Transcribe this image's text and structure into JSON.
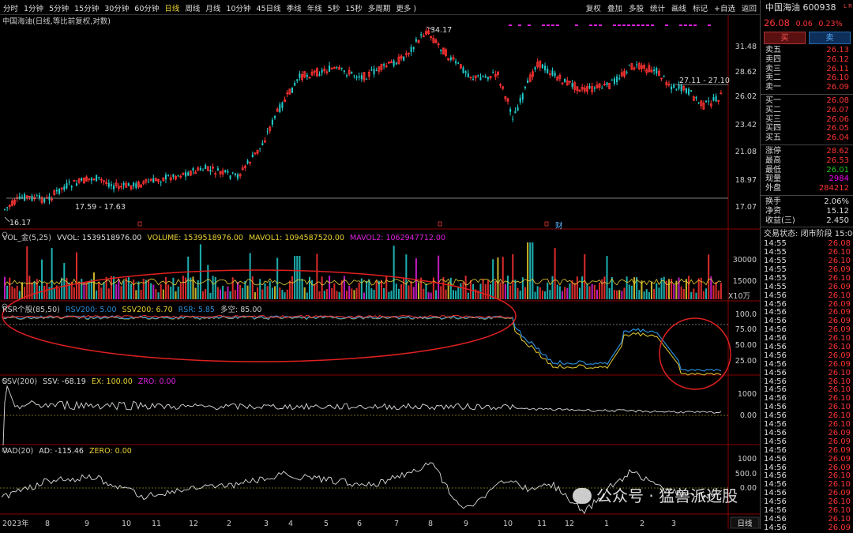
{
  "toolbar": {
    "periods": [
      "分时",
      "1分钟",
      "5分钟",
      "15分钟",
      "30分钟",
      "60分钟",
      "日线",
      "周线",
      "月线",
      "10分钟",
      "45日线",
      "季线",
      "年线",
      "5秒",
      "15秒",
      "多周期",
      "更多 )"
    ],
    "active_period": "日线",
    "tools": [
      "复权",
      "叠加",
      "多股",
      "统计",
      "画线",
      "标记",
      "+自选",
      "返回"
    ]
  },
  "main_pane": {
    "title": "中国海油(日线,等比前复权,对数)",
    "y_ticks": [
      "31.48",
      "28.62",
      "26.02",
      "23.42",
      "21.08",
      "18.97",
      "17.07"
    ],
    "annotations": {
      "high": "34.17",
      "low": "16.17",
      "support": "17.59 - 17.63",
      "resistance": "27.11 - 27.10"
    },
    "event_markers": [
      "财"
    ]
  },
  "vol_pane": {
    "label_name": "VOL_金(5,25)",
    "vvol": "VVOL: 1539518976.00",
    "volume": "VOLUME: 1539518976.00",
    "mavol1": "MAVOL1: 1094587520.00",
    "mavol2": "MAVOL2: 1062947712.00",
    "y_ticks": [
      "30000",
      "15000"
    ],
    "unit": "X10万"
  },
  "rsr_pane": {
    "label_name": "RSR个股(85,50)",
    "rsv200": "RSV200: 5.00",
    "ssv200": "SSV200: 6.70",
    "rsr": "RSR: 5.85",
    "duokong": "多空: 85.00",
    "y_ticks": [
      "100.0",
      "75.00",
      "50.00",
      "25.00"
    ]
  },
  "ssv_pane": {
    "label_name": "SSV(200)",
    "ssv": "SSV: -68.19",
    "ex": "EX: 100.00",
    "zro": "ZRO: 0.00",
    "y_ticks": [
      "1000",
      "0.00"
    ]
  },
  "vad_pane": {
    "label_name": "VAD(20)",
    "ad": "AD: -115.46",
    "zero": "ZERO: 0.00",
    "y_ticks": [
      "1000",
      "500.0",
      "0.00"
    ]
  },
  "x_axis": {
    "labels": [
      "2023年",
      "8",
      "9",
      "10",
      "11",
      "12",
      "2",
      "3",
      "4",
      "5",
      "6",
      "7",
      "8",
      "9",
      "10",
      "11",
      "12",
      "1",
      "2",
      "3"
    ],
    "period_tag": "日线"
  },
  "quote_panel": {
    "name": "中国海油",
    "code": "600938",
    "lr_tag": "L R",
    "price": "26.08",
    "change": "0.06",
    "change_pct": "0.23%",
    "buy_label": "买",
    "sell_label": "卖",
    "asks": [
      {
        "label": "卖五",
        "price": "26.13"
      },
      {
        "label": "卖四",
        "price": "26.12"
      },
      {
        "label": "卖三",
        "price": "26.11"
      },
      {
        "label": "卖二",
        "price": "26.10"
      },
      {
        "label": "卖一",
        "price": "26.09"
      }
    ],
    "bids": [
      {
        "label": "买一",
        "price": "26.08"
      },
      {
        "label": "买二",
        "price": "26.07"
      },
      {
        "label": "买三",
        "price": "26.06"
      },
      {
        "label": "买四",
        "price": "26.05"
      },
      {
        "label": "买五",
        "price": "26.04"
      }
    ],
    "stats": [
      {
        "label": "涨停",
        "value": "28.62"
      },
      {
        "label": "最高",
        "value": "26.53"
      },
      {
        "label": "最低",
        "value": "26.01"
      },
      {
        "label": "现量",
        "value": "2984"
      },
      {
        "label": "外盘",
        "value": "284212"
      }
    ],
    "stats2": [
      {
        "label": "换手",
        "value": "2.06%"
      },
      {
        "label": "净资",
        "value": "15.12"
      },
      {
        "label": "收益(三)",
        "value": "2.450"
      }
    ],
    "trade_status": "交易状态: 闭市阶段 15:00",
    "ticks": [
      {
        "time": "14:55",
        "price": "26.08"
      },
      {
        "time": "14:55",
        "price": "26.10"
      },
      {
        "time": "14:55",
        "price": "26.10"
      },
      {
        "time": "14:55",
        "price": "26.09"
      },
      {
        "time": "14:55",
        "price": "26.10"
      },
      {
        "time": "14:55",
        "price": "26.09"
      },
      {
        "time": "14:56",
        "price": "26.10"
      },
      {
        "time": "14:56",
        "price": "26.09"
      },
      {
        "time": "14:56",
        "price": "26.09"
      },
      {
        "time": "14:56",
        "price": "26.09"
      },
      {
        "time": "14:56",
        "price": "26.09"
      },
      {
        "time": "14:56",
        "price": "26.10"
      },
      {
        "time": "14:56",
        "price": "26.10"
      },
      {
        "time": "14:56",
        "price": "26.09"
      },
      {
        "time": "14:56",
        "price": "26.09"
      },
      {
        "time": "14:56",
        "price": "26.10"
      },
      {
        "time": "14:56",
        "price": "26.10"
      },
      {
        "time": "14:56",
        "price": "26.10"
      },
      {
        "time": "14:56",
        "price": "26.10"
      },
      {
        "time": "14:56",
        "price": "26.10"
      },
      {
        "time": "14:56",
        "price": "26.10"
      },
      {
        "time": "14:56",
        "price": "26.10"
      },
      {
        "time": "14:56",
        "price": "26.09"
      },
      {
        "time": "14:56",
        "price": "26.09"
      },
      {
        "time": "14:56",
        "price": "26.09"
      },
      {
        "time": "14:56",
        "price": "26.09"
      },
      {
        "time": "14:56",
        "price": "26.09"
      },
      {
        "time": "14:56",
        "price": "26.10"
      },
      {
        "time": "14:56",
        "price": "26.10"
      },
      {
        "time": "14:56",
        "price": "26.09"
      },
      {
        "time": "14:56",
        "price": "26.10"
      },
      {
        "time": "14:56",
        "price": "26.10"
      },
      {
        "time": "14:56",
        "price": "26.10"
      },
      {
        "time": "14:56",
        "price": "26.09"
      }
    ]
  },
  "watermark": "公众号 · 猛兽派选股",
  "colors": {
    "up": "#ff3333",
    "down": "#22cccc",
    "grid": "#8b0000",
    "accent_yellow": "#e8d032",
    "magenta": "#e020e0"
  }
}
